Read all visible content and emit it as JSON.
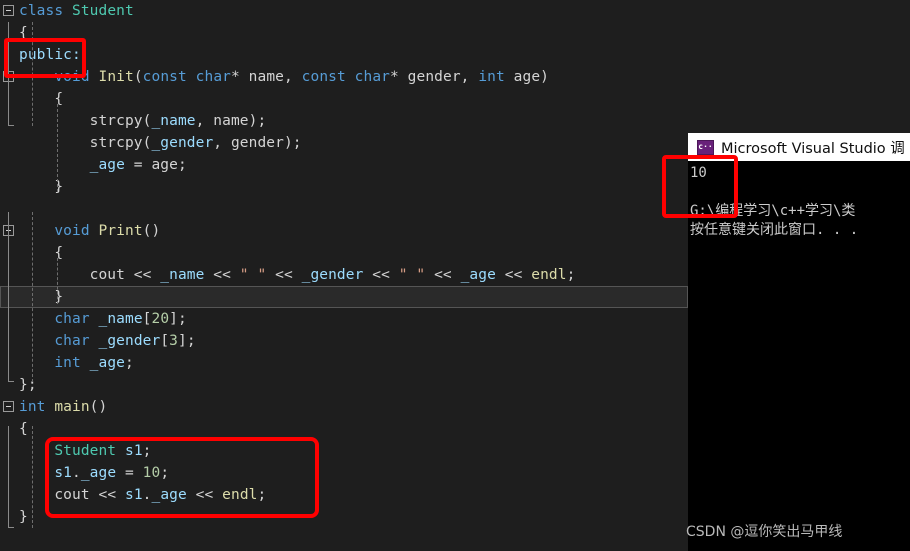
{
  "editor": {
    "lines": [
      {
        "fold": true,
        "tokens": [
          {
            "t": "class",
            "c": "kw"
          },
          {
            "t": " ",
            "c": "pun"
          },
          {
            "t": "Student",
            "c": "type"
          }
        ]
      },
      {
        "fold": false,
        "tokens": [
          {
            "t": "{",
            "c": "pun"
          }
        ]
      },
      {
        "fold": false,
        "tokens": [
          {
            "t": "public:",
            "c": "pl"
          }
        ]
      },
      {
        "fold": true,
        "tokens": [
          {
            "t": "    ",
            "c": "pun"
          },
          {
            "t": "void",
            "c": "kw"
          },
          {
            "t": " ",
            "c": "pun"
          },
          {
            "t": "Init",
            "c": "fn"
          },
          {
            "t": "(",
            "c": "pun"
          },
          {
            "t": "const",
            "c": "kw"
          },
          {
            "t": " ",
            "c": "pun"
          },
          {
            "t": "char",
            "c": "kw"
          },
          {
            "t": "* ",
            "c": "pun"
          },
          {
            "t": "name",
            "c": "id"
          },
          {
            "t": ", ",
            "c": "pun"
          },
          {
            "t": "const",
            "c": "kw"
          },
          {
            "t": " ",
            "c": "pun"
          },
          {
            "t": "char",
            "c": "kw"
          },
          {
            "t": "* ",
            "c": "pun"
          },
          {
            "t": "gender",
            "c": "id"
          },
          {
            "t": ", ",
            "c": "pun"
          },
          {
            "t": "int",
            "c": "kw"
          },
          {
            "t": " ",
            "c": "pun"
          },
          {
            "t": "age",
            "c": "id"
          },
          {
            "t": ")",
            "c": "pun"
          }
        ]
      },
      {
        "fold": false,
        "tokens": [
          {
            "t": "    {",
            "c": "pun"
          }
        ]
      },
      {
        "fold": false,
        "tokens": [
          {
            "t": "        ",
            "c": "pun"
          },
          {
            "t": "strcpy",
            "c": "id"
          },
          {
            "t": "(",
            "c": "pun"
          },
          {
            "t": "_name",
            "c": "pl"
          },
          {
            "t": ", ",
            "c": "pun"
          },
          {
            "t": "name",
            "c": "id"
          },
          {
            "t": ");",
            "c": "pun"
          }
        ]
      },
      {
        "fold": false,
        "tokens": [
          {
            "t": "        ",
            "c": "pun"
          },
          {
            "t": "strcpy",
            "c": "id"
          },
          {
            "t": "(",
            "c": "pun"
          },
          {
            "t": "_gender",
            "c": "pl"
          },
          {
            "t": ", ",
            "c": "pun"
          },
          {
            "t": "gender",
            "c": "id"
          },
          {
            "t": ");",
            "c": "pun"
          }
        ]
      },
      {
        "fold": false,
        "tokens": [
          {
            "t": "        ",
            "c": "pun"
          },
          {
            "t": "_age",
            "c": "pl"
          },
          {
            "t": " = ",
            "c": "pun"
          },
          {
            "t": "age",
            "c": "id"
          },
          {
            "t": ";",
            "c": "pun"
          }
        ]
      },
      {
        "fold": false,
        "tokens": [
          {
            "t": "    }",
            "c": "pun"
          }
        ]
      },
      {
        "fold": false,
        "tokens": []
      },
      {
        "fold": true,
        "tokens": [
          {
            "t": "    ",
            "c": "pun"
          },
          {
            "t": "void",
            "c": "kw"
          },
          {
            "t": " ",
            "c": "pun"
          },
          {
            "t": "Print",
            "c": "fn"
          },
          {
            "t": "()",
            "c": "pun"
          }
        ]
      },
      {
        "fold": false,
        "tokens": [
          {
            "t": "    {",
            "c": "pun"
          }
        ]
      },
      {
        "fold": false,
        "tokens": [
          {
            "t": "        ",
            "c": "pun"
          },
          {
            "t": "cout",
            "c": "id"
          },
          {
            "t": " << ",
            "c": "pun"
          },
          {
            "t": "_name",
            "c": "pl"
          },
          {
            "t": " << ",
            "c": "pun"
          },
          {
            "t": "\" \"",
            "c": "str"
          },
          {
            "t": " << ",
            "c": "pun"
          },
          {
            "t": "_gender",
            "c": "pl"
          },
          {
            "t": " << ",
            "c": "pun"
          },
          {
            "t": "\" \"",
            "c": "str"
          },
          {
            "t": " << ",
            "c": "pun"
          },
          {
            "t": "_age",
            "c": "pl"
          },
          {
            "t": " << ",
            "c": "pun"
          },
          {
            "t": "endl",
            "c": "fn"
          },
          {
            "t": ";",
            "c": "pun"
          }
        ]
      },
      {
        "fold": false,
        "highlight": true,
        "tokens": [
          {
            "t": "    }",
            "c": "pun"
          }
        ]
      },
      {
        "fold": false,
        "tokens": [
          {
            "t": "    ",
            "c": "pun"
          },
          {
            "t": "char",
            "c": "kw"
          },
          {
            "t": " ",
            "c": "pun"
          },
          {
            "t": "_name",
            "c": "pl"
          },
          {
            "t": "[",
            "c": "pun"
          },
          {
            "t": "20",
            "c": "num"
          },
          {
            "t": "];",
            "c": "pun"
          }
        ]
      },
      {
        "fold": false,
        "tokens": [
          {
            "t": "    ",
            "c": "pun"
          },
          {
            "t": "char",
            "c": "kw"
          },
          {
            "t": " ",
            "c": "pun"
          },
          {
            "t": "_gender",
            "c": "pl"
          },
          {
            "t": "[",
            "c": "pun"
          },
          {
            "t": "3",
            "c": "num"
          },
          {
            "t": "];",
            "c": "pun"
          }
        ]
      },
      {
        "fold": false,
        "tokens": [
          {
            "t": "    ",
            "c": "pun"
          },
          {
            "t": "int",
            "c": "kw"
          },
          {
            "t": " ",
            "c": "pun"
          },
          {
            "t": "_age",
            "c": "pl"
          },
          {
            "t": ";",
            "c": "pun"
          }
        ]
      },
      {
        "fold": false,
        "tokens": [
          {
            "t": "};",
            "c": "pun"
          }
        ]
      },
      {
        "fold": true,
        "tokens": [
          {
            "t": "int",
            "c": "kw"
          },
          {
            "t": " ",
            "c": "pun"
          },
          {
            "t": "main",
            "c": "fn"
          },
          {
            "t": "()",
            "c": "pun"
          }
        ]
      },
      {
        "fold": false,
        "tokens": [
          {
            "t": "{",
            "c": "pun"
          }
        ]
      },
      {
        "fold": false,
        "tokens": [
          {
            "t": "    ",
            "c": "pun"
          },
          {
            "t": "Student",
            "c": "type"
          },
          {
            "t": " ",
            "c": "pun"
          },
          {
            "t": "s1",
            "c": "pl"
          },
          {
            "t": ";",
            "c": "pun"
          }
        ]
      },
      {
        "fold": false,
        "tokens": [
          {
            "t": "    ",
            "c": "pun"
          },
          {
            "t": "s1",
            "c": "pl"
          },
          {
            "t": ".",
            "c": "pun"
          },
          {
            "t": "_age",
            "c": "pl"
          },
          {
            "t": " = ",
            "c": "pun"
          },
          {
            "t": "10",
            "c": "num"
          },
          {
            "t": ";",
            "c": "pun"
          }
        ]
      },
      {
        "fold": false,
        "tokens": [
          {
            "t": "    ",
            "c": "pun"
          },
          {
            "t": "cout",
            "c": "id"
          },
          {
            "t": " << ",
            "c": "pun"
          },
          {
            "t": "s1",
            "c": "pl"
          },
          {
            "t": ".",
            "c": "pun"
          },
          {
            "t": "_age",
            "c": "pl"
          },
          {
            "t": " << ",
            "c": "pun"
          },
          {
            "t": "endl",
            "c": "fn"
          },
          {
            "t": ";",
            "c": "pun"
          }
        ]
      },
      {
        "fold": false,
        "tokens": [
          {
            "t": "}",
            "c": "pun"
          }
        ]
      }
    ]
  },
  "console": {
    "icon": "visual-studio-console-icon",
    "icon_glyph": "c··",
    "title": "Microsoft Visual Studio 调",
    "output_value": "10",
    "path_line": "G:\\编程学习\\c++学习\\类",
    "prompt_line": "按任意键关闭此窗口. . ."
  },
  "annotations": {
    "box_public": "public:",
    "box_main_body": "Student s1; / s1._age = 10; / cout << s1._age << endl;",
    "box_console_output": "10",
    "highlight_color": "#ff0000"
  },
  "watermark": {
    "text": "CSDN @逗你笑出马甲线"
  },
  "theme": {
    "editor_bg": "#1e1e1e",
    "console_bg": "#000000",
    "keyword": "#569cd6",
    "type": "#4ec9b0",
    "function": "#dcdcaa",
    "identifier": "#d4d4d4",
    "member": "#9cdcfe",
    "number": "#b5cea8",
    "string": "#d69d85"
  }
}
